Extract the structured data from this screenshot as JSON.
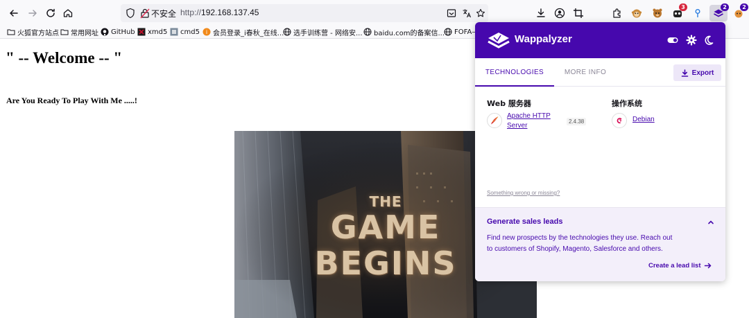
{
  "browser": {
    "url": {
      "security_label": "不安全",
      "scheme": "http://",
      "host": "192.168.137.45"
    },
    "extension_badges": {
      "extension_3": "3",
      "wappalyzer": "2",
      "extension_last": "2"
    }
  },
  "bookmarks": [
    {
      "label": "火狐官方站点",
      "icon": "folder-icon"
    },
    {
      "label": "常用网址",
      "icon": "folder-icon"
    },
    {
      "label": "GitHub",
      "icon": "github-icon"
    },
    {
      "label": "xmd5",
      "icon": "xmd5-icon"
    },
    {
      "label": "cmd5",
      "icon": "cmd5-icon"
    },
    {
      "label": "会员登录_i春秋_在线...",
      "icon": "ichunqiu-icon"
    },
    {
      "label": "选手训练营 - 网络安...",
      "icon": "globe-icon"
    },
    {
      "label": "baidu.com的备案信...",
      "icon": "globe-icon"
    },
    {
      "label": "FOFA—",
      "icon": "globe-icon"
    }
  ],
  "page": {
    "heading": "\" -- Welcome -- \"",
    "subheading": "Are You Ready To Play With Me .....!",
    "hero": {
      "line1": "THE",
      "line2": "GAME",
      "line3": "BEGINS"
    }
  },
  "wappalyzer": {
    "title": "Wappalyzer",
    "tabs": {
      "technologies": "TECHNOLOGIES",
      "more_info": "MORE INFO"
    },
    "export_label": "Export",
    "categories": [
      {
        "name": "Web 服务器",
        "tech": {
          "name_line1": "Apache HTTP",
          "name_line2": "Server",
          "version": "2.4.38",
          "icon": "apache-feather-icon"
        }
      },
      {
        "name": "操作系统",
        "tech": {
          "name": "Debian",
          "icon": "debian-swirl-icon"
        }
      }
    ],
    "wrong_link": "Something wrong or missing?",
    "leads": {
      "title": "Generate sales leads",
      "body_line1": "Find new prospects by the technologies they use. Reach out",
      "body_line2": "to customers of Shopify, Magento, Salesforce and others.",
      "cta": "Create a lead list"
    },
    "colors": {
      "brand": "#4608ad",
      "leads_bg": "#f3effa"
    }
  }
}
